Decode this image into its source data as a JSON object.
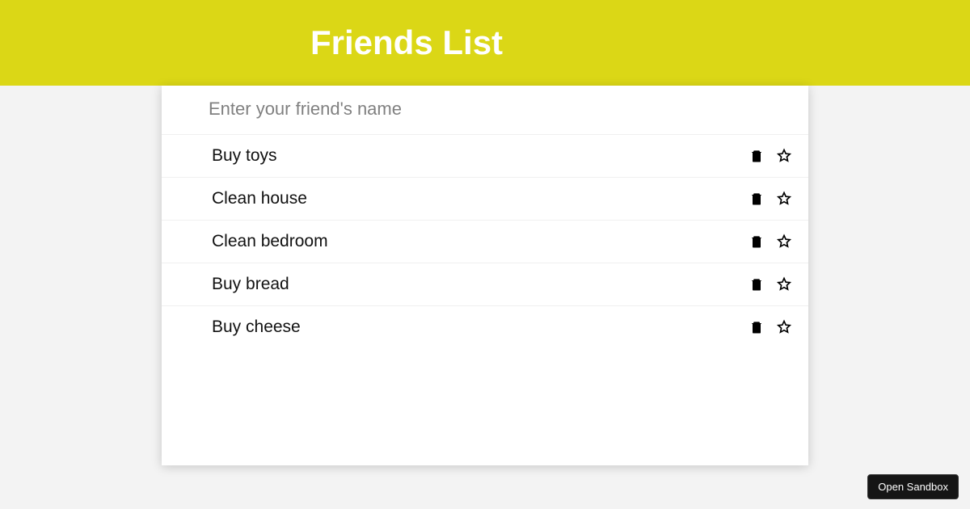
{
  "header": {
    "title": "Friends List"
  },
  "input": {
    "placeholder": "Enter your friend's name",
    "value": ""
  },
  "items": [
    {
      "label": "Buy toys"
    },
    {
      "label": "Clean house"
    },
    {
      "label": "Clean bedroom"
    },
    {
      "label": "Buy bread"
    },
    {
      "label": "Buy cheese"
    }
  ],
  "footer": {
    "sandbox_label": "Open Sandbox"
  }
}
